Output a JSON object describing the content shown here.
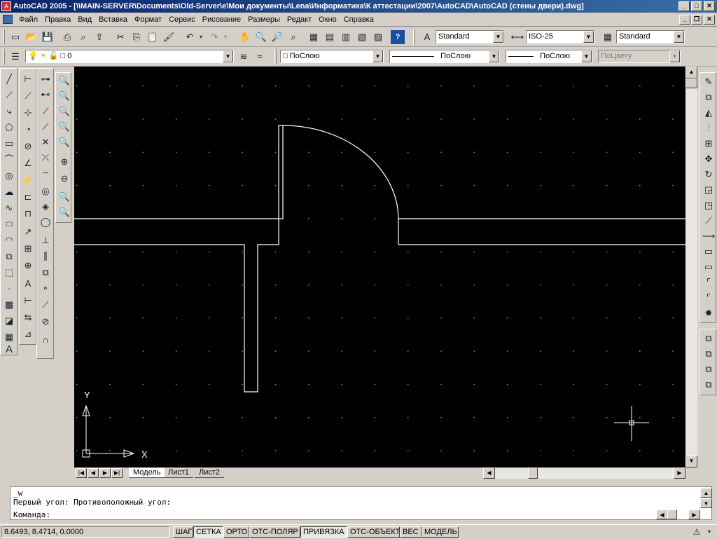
{
  "window": {
    "title": "AutoCAD 2005 - [\\\\MAIN-SERVER\\Documents\\Old-Server\\e\\Мои документы\\Lena\\Информатика\\К аттестации\\2007\\AutoCAD\\AutoCAD (стены двери).dwg]",
    "controls": [
      "_",
      "□",
      "✕"
    ]
  },
  "menu": [
    "Файл",
    "Правка",
    "Вид",
    "Вставка",
    "Формат",
    "Сервис",
    "Рисование",
    "Размеры",
    "Редакт",
    "Окно",
    "Справка"
  ],
  "toolbar_styles": {
    "text_style": "Standard",
    "dim_style": "ISO-25",
    "table_style": "Standard"
  },
  "toolbar_layers": {
    "layer": "0",
    "color": "ПоСлою",
    "linetype": "ПоСлою",
    "lineweight": "ПоСлою",
    "plotstyle": "ПоЦвету"
  },
  "layout_tabs": [
    "Модель",
    "Лист1",
    "Лист2"
  ],
  "command_window": {
    "lines": [
      "_w",
      "Первый угол: Противоположный угол:"
    ],
    "prompt": "Команда:"
  },
  "status": {
    "coordinates": "8.6493, 8.4714, 0.0000",
    "toggles": [
      {
        "label": "ШАГ",
        "on": false
      },
      {
        "label": "СЕТКА",
        "on": true
      },
      {
        "label": "ОРТО",
        "on": false
      },
      {
        "label": "ОТС-ПОЛЯР",
        "on": false
      },
      {
        "label": "ПРИВЯЗКА",
        "on": true
      },
      {
        "label": "ОТС-ОБЪЕКТ",
        "on": false
      },
      {
        "label": "ВЕС",
        "on": false
      },
      {
        "label": "МОДЕЛЬ",
        "on": false
      }
    ]
  },
  "ucs": {
    "x_label": "X",
    "y_label": "Y"
  },
  "colors": {
    "canvas": "#000000",
    "lines": "#ffffff",
    "grid": "#9a9a9a",
    "titlebar": "#0a246a"
  }
}
